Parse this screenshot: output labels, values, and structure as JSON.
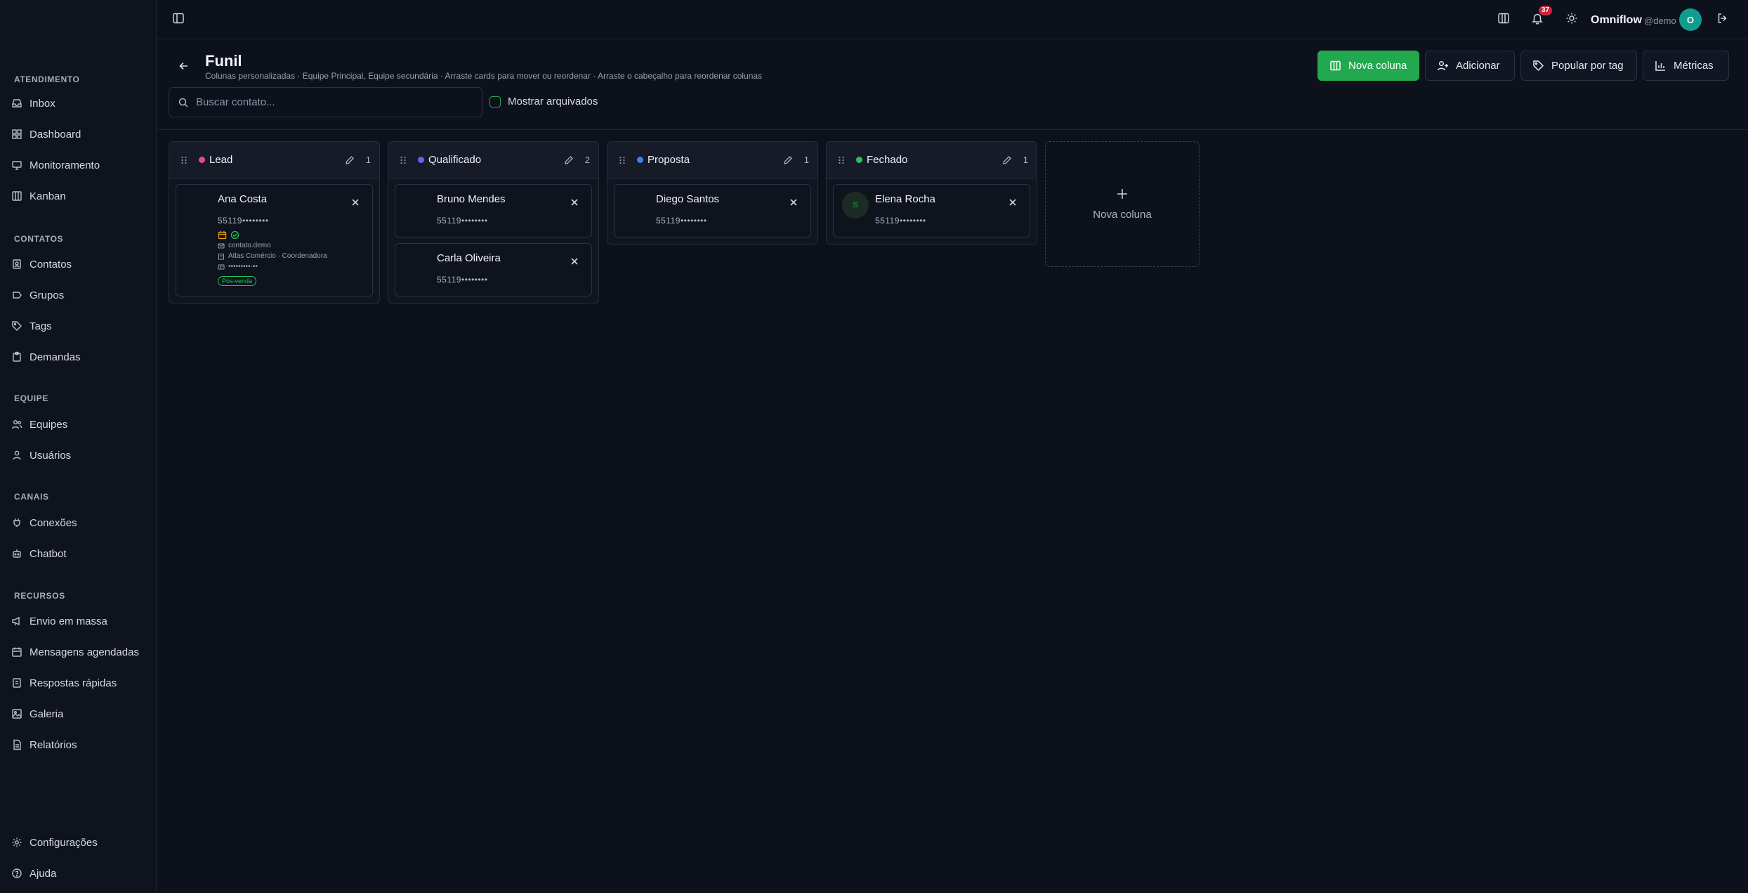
{
  "sidebar": {
    "sections": [
      {
        "title": "ATENDIMENTO",
        "items": [
          {
            "label": "Inbox",
            "icon": "inbox-icon"
          },
          {
            "label": "Dashboard",
            "icon": "dashboard-icon"
          },
          {
            "label": "Monitoramento",
            "icon": "monitor-icon"
          },
          {
            "label": "Kanban",
            "icon": "kanban-icon"
          }
        ]
      },
      {
        "title": "CONTATOS",
        "items": [
          {
            "label": "Contatos",
            "icon": "contacts-icon"
          },
          {
            "label": "Grupos",
            "icon": "groups-icon"
          },
          {
            "label": "Tags",
            "icon": "tag-icon"
          },
          {
            "label": "Demandas",
            "icon": "clipboard-icon"
          }
        ]
      },
      {
        "title": "EQUIPE",
        "items": [
          {
            "label": "Equipes",
            "icon": "team-icon"
          },
          {
            "label": "Usuários",
            "icon": "user-icon"
          }
        ]
      },
      {
        "title": "CANAIS",
        "items": [
          {
            "label": "Conexões",
            "icon": "plug-icon"
          },
          {
            "label": "Chatbot",
            "icon": "bot-icon"
          }
        ]
      },
      {
        "title": "RECURSOS",
        "items": [
          {
            "label": "Envio em massa",
            "icon": "megaphone-icon"
          },
          {
            "label": "Mensagens agendadas",
            "icon": "calendar-icon"
          },
          {
            "label": "Respostas rápidas",
            "icon": "quick-reply-icon"
          },
          {
            "label": "Galeria",
            "icon": "gallery-icon"
          },
          {
            "label": "Relatórios",
            "icon": "report-icon"
          }
        ]
      }
    ],
    "footer": {
      "settings": "Configurações",
      "help": "Ajuda"
    }
  },
  "topbar": {
    "notifications_count": "37",
    "brand": "Omniflow",
    "brand_sub": "@demo",
    "avatar_initial": "O"
  },
  "header": {
    "title": "Funil",
    "subtitle": "Colunas personalizadas · Equipe Principal, Equipe secundária · Arraste cards para mover ou reordenar · Arraste o cabeçalho para reordenar colunas",
    "buttons": {
      "new_column": "Nova coluna",
      "add": "Adicionar",
      "populate_by_tag": "Popular por tag",
      "metrics": "Métricas"
    }
  },
  "filters": {
    "search_placeholder": "Buscar contato...",
    "show_archived": "Mostrar arquivados"
  },
  "columns": [
    {
      "name": "Lead",
      "color": "#ec4899",
      "count": "1",
      "cards": [
        {
          "name": "Ana Costa",
          "phone": "55119••••••••",
          "email": "contato.demo",
          "company": "Atlas Comércio · Coordenadora",
          "doc": "•••••••••-••",
          "tag": "Pós-venda"
        }
      ]
    },
    {
      "name": "Qualificado",
      "color": "#6366f1",
      "count": "2",
      "cards": [
        {
          "name": "Bruno Mendes",
          "phone": "55119••••••••"
        },
        {
          "name": "Carla Oliveira",
          "phone": "55119••••••••"
        }
      ]
    },
    {
      "name": "Proposta",
      "color": "#3b82f6",
      "count": "1",
      "cards": [
        {
          "name": "Diego Santos",
          "phone": "55119••••••••"
        }
      ]
    },
    {
      "name": "Fechado",
      "color": "#22c55e",
      "count": "1",
      "cards": [
        {
          "name": "Elena Rocha",
          "phone": "55119••••••••",
          "avatar": "S"
        }
      ]
    }
  ],
  "new_column_placeholder": "Nova coluna"
}
